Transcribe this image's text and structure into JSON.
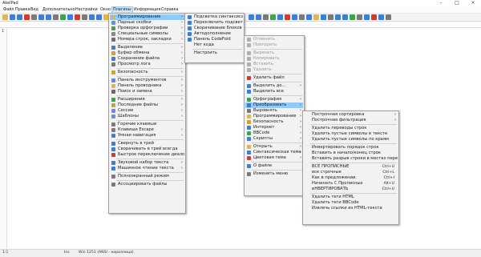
{
  "window": {
    "title": "AkelPad"
  },
  "menubar": [
    "Файл",
    "Правка",
    "Вид",
    "Дополнительно",
    "Настройки",
    "Окно",
    "Плагины",
    "Информация",
    "Справка"
  ],
  "gutter": {
    "line": "1"
  },
  "status": {
    "pos": "1:1",
    "mode": "Ins",
    "enc": "Win  1251 (ANSI - кириллица)"
  },
  "colors": {
    "highlight": "#91c9f7",
    "menu_bg": "#f2f2f2",
    "red": "#d33b2c",
    "green": "#36a336",
    "blue": "#2d6fd1"
  },
  "menu1": [
    {
      "label": "Программирование",
      "arrow": true,
      "sel": true,
      "icon": "folder-icon",
      "c": "#e3b64a"
    },
    {
      "label": "Парные скобки",
      "arrow": true,
      "icon": "brackets-icon",
      "c": "#6a8fd0"
    },
    {
      "label": "Проверка орфографии",
      "arrow": true,
      "icon": "spell-icon",
      "c": "#3fa34d"
    },
    {
      "label": "Специальные символы",
      "arrow": true,
      "icon": "special-chars-icon",
      "c": "#888888"
    },
    {
      "label": "Номера строк, закладки",
      "arrow": true,
      "icon": "numbers-icon",
      "c": "#6f6f6f"
    },
    {
      "sep": true
    },
    {
      "label": "Выделение",
      "arrow": true,
      "icon": "select-icon",
      "c": "#3d7fd6"
    },
    {
      "label": "Буфер обмена",
      "arrow": true,
      "icon": "clipboard-icon",
      "c": "#c8a04a"
    },
    {
      "label": "Сохранение файла",
      "arrow": true,
      "icon": "save-icon",
      "c": "#3d7fd6"
    },
    {
      "label": "Просмотр лога",
      "arrow": true,
      "icon": "log-icon",
      "c": "#7a7a7a"
    },
    {
      "sep": true
    },
    {
      "label": "Безопасность",
      "arrow": true,
      "icon": "lock-icon",
      "c": "#d0a13a"
    },
    {
      "sep": true
    },
    {
      "label": "Панель инструментов",
      "arrow": true,
      "icon": "toolbar-icon",
      "c": "#5a8fcf"
    },
    {
      "label": "Панель проводника",
      "arrow": true,
      "icon": "explorer-icon",
      "c": "#e0b548"
    },
    {
      "label": "Поиск и замена",
      "arrow": true,
      "icon": "search-icon",
      "c": "#6a6a6a"
    },
    {
      "sep": true
    },
    {
      "label": "Расширения",
      "arrow": true,
      "icon": "extensions-icon",
      "c": "#3fa34d"
    },
    {
      "label": "Последние файлы",
      "arrow": true,
      "icon": "recent-icon",
      "c": "#d0a13a"
    },
    {
      "label": "Сессии",
      "arrow": true,
      "icon": "sessions-icon",
      "c": "#6a8fd0"
    },
    {
      "label": "Шаблоны",
      "arrow": true,
      "icon": "templates-icon",
      "c": "#6a8fd0"
    },
    {
      "sep": true
    },
    {
      "label": "Горячие клавиши",
      "arrow": false,
      "icon": "hotkeys-icon",
      "c": "#7a7a7a"
    },
    {
      "label": "Клавиши Escape",
      "arrow": true,
      "icon": "escape-icon",
      "c": "#7a7a7a"
    },
    {
      "label": "Умная навигация",
      "arrow": true,
      "icon": "navigation-icon",
      "c": "#3d7fd6"
    },
    {
      "sep": true
    },
    {
      "label": "Свернуть в трей",
      "arrow": false,
      "icon": "tray-icon",
      "c": "#3d7fd6"
    },
    {
      "label": "Сворачивать в трей всегда",
      "arrow": false,
      "icon": "tray-always-icon",
      "c": "#3d7fd6"
    },
    {
      "label": "Быстрое переключение диалогов",
      "arrow": false,
      "icon": "dialogs-icon",
      "c": "#d33b2c"
    },
    {
      "sep": true
    },
    {
      "label": "Звуковой набор текста",
      "arrow": true,
      "icon": "sound-icon",
      "c": "#3d7fd6"
    },
    {
      "label": "Машинное чтение текста",
      "arrow": true,
      "icon": "speech-icon",
      "c": "#3d7fd6"
    },
    {
      "sep": true
    },
    {
      "label": "Полноэкранный режим",
      "arrow": false,
      "icon": "fullscreen-icon",
      "c": "#7a7a7a"
    },
    {
      "sep": true
    },
    {
      "label": "Ассоциировать файлы",
      "arrow": false,
      "icon": "associate-icon",
      "c": "#7a7a7a"
    }
  ],
  "menu2": [
    {
      "label": "Подсветка синтаксиса",
      "icon": "highlight-icon",
      "c": "#3d7fd6"
    },
    {
      "label": "Переключить подсветку",
      "icon": "toggle-icon",
      "c": "#3d7fd6"
    },
    {
      "label": "Сворачивание блоков",
      "icon": "fold-icon",
      "c": "#3d7fd6"
    },
    {
      "label": "Автодополнение",
      "icon": "autocomplete-icon",
      "c": "#3d7fd6"
    },
    {
      "label": "Панель CodeFold",
      "icon": "codefold-icon",
      "c": "#3d7fd6"
    },
    {
      "label": "Нет кода",
      "icon": "",
      "c": ""
    },
    {
      "sep": true
    },
    {
      "label": "Настроить",
      "icon": "",
      "c": ""
    }
  ],
  "menu3": [
    {
      "label": "Отменить",
      "dis": true,
      "icon": "undo-icon",
      "c": "#b0b0b0"
    },
    {
      "label": "Повторить",
      "dis": true,
      "icon": "redo-icon",
      "c": "#b0b0b0"
    },
    {
      "sep": true
    },
    {
      "label": "Вырезать",
      "dis": true,
      "icon": "cut-icon",
      "c": "#b0b0b0"
    },
    {
      "label": "Копировать",
      "dis": true,
      "icon": "copy-icon",
      "c": "#b0b0b0"
    },
    {
      "label": "Вставить",
      "dis": true,
      "icon": "paste-icon",
      "c": "#b0b0b0"
    },
    {
      "label": "Удалить",
      "dis": true,
      "icon": "delete-icon",
      "c": "#b0b0b0"
    },
    {
      "sep": true
    },
    {
      "label": "Удалить файл",
      "icon": "delete-file-icon",
      "c": "#d33b2c"
    },
    {
      "sep": true
    },
    {
      "label": "Выделить до...",
      "arrow": true,
      "icon": "select-to-icon",
      "c": "#3d7fd6"
    },
    {
      "label": "Выделить все",
      "icon": "select-all-icon",
      "c": "#3d7fd6"
    },
    {
      "sep": true
    },
    {
      "label": "Орфография",
      "arrow": true,
      "icon": "spelling-icon",
      "c": "#3fa34d"
    },
    {
      "label": "Преобразовать",
      "arrow": true,
      "sel": true,
      "icon": "convert-icon",
      "c": "#3d7fd6"
    },
    {
      "label": "Выровнять",
      "arrow": true,
      "icon": "align-icon",
      "c": "#7a7a7a"
    },
    {
      "label": "Программирование",
      "arrow": true,
      "icon": "code-icon",
      "c": "#e3b64a"
    },
    {
      "label": "Безопасность",
      "arrow": true,
      "icon": "security-icon",
      "c": "#d0a13a"
    },
    {
      "label": "Интернет",
      "arrow": true,
      "icon": "internet-icon",
      "c": "#3d7fd6"
    },
    {
      "label": "BBCode",
      "arrow": true,
      "icon": "bbcode-icon",
      "c": "#3fa34d"
    },
    {
      "label": "Скрипты",
      "arrow": true,
      "icon": "scripts-icon",
      "c": "#3d7fd6"
    },
    {
      "sep": true
    },
    {
      "label": "Открыть",
      "arrow": true,
      "icon": "open-icon",
      "c": "#e3b64a"
    },
    {
      "label": "Синтаксическая тема",
      "arrow": true,
      "icon": "syntax-theme-icon",
      "c": "#3d7fd6"
    },
    {
      "label": "Цветовая тема",
      "arrow": true,
      "icon": "color-theme-icon",
      "c": "#d33b2c"
    },
    {
      "sep": true
    },
    {
      "label": "О файле",
      "icon": "file-info-icon",
      "c": "#3d7fd6"
    },
    {
      "sep": true
    },
    {
      "label": "Изменить меню",
      "icon": "edit-menu-icon",
      "c": "#7a7a7a"
    }
  ],
  "menu4": [
    {
      "label": "Построчная сортировка",
      "arrow": true
    },
    {
      "label": "Построчная фильтрация",
      "arrow": true
    },
    {
      "sep": true
    },
    {
      "label": "Удалить переводы строк"
    },
    {
      "label": "Удалить пустые символы в тексте"
    },
    {
      "label": "Удалить пустые символы по краям"
    },
    {
      "sep": true
    },
    {
      "label": "Инвертировать порядок строк"
    },
    {
      "label": "Вставить в начало/конец строк"
    },
    {
      "label": "Вставить разрыв строки в местах переноса"
    },
    {
      "sep": true
    },
    {
      "label": "ВСЕ ПРОПИСНЫЕ",
      "sc": "Ctrl+U"
    },
    {
      "label": "все строчные",
      "sc": "Ctrl+L"
    },
    {
      "label": "Как в предложении.",
      "sc": "Ctrl+I"
    },
    {
      "label": "Начинать С Прописных",
      "sc": "Alt+U"
    },
    {
      "label": "иНВЕРТИРОВАТЬ",
      "sc": "Ctrl+U"
    },
    {
      "sep": true
    },
    {
      "label": "Удалить теги HTML"
    },
    {
      "label": "Удалить теги BBCode"
    },
    {
      "label": "Извлечь ссылки из HTML-текста"
    }
  ]
}
